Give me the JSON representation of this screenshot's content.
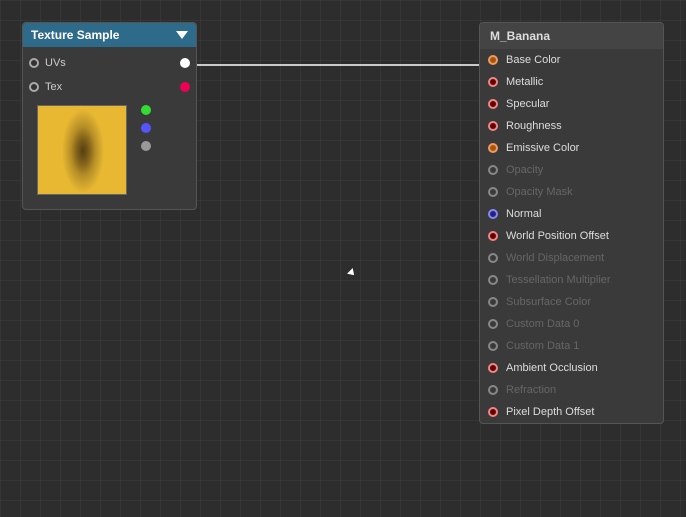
{
  "canvas": {
    "background": "#2d2d2d"
  },
  "texture_sample_node": {
    "title": "Texture Sample",
    "pins": [
      {
        "label": "UVs",
        "pin_color": "white",
        "side": "both"
      },
      {
        "label": "Tex",
        "pin_color": "red",
        "side": "right"
      }
    ],
    "output_pins": [
      "red",
      "green",
      "blue",
      "gray"
    ]
  },
  "material_node": {
    "title": "M_Banana",
    "rows": [
      {
        "label": "Base Color",
        "active": true,
        "pin_type": "orange"
      },
      {
        "label": "Metallic",
        "active": true,
        "pin_type": "default"
      },
      {
        "label": "Specular",
        "active": true,
        "pin_type": "default"
      },
      {
        "label": "Roughness",
        "active": true,
        "pin_type": "default"
      },
      {
        "label": "Emissive Color",
        "active": true,
        "pin_type": "orange"
      },
      {
        "label": "Opacity",
        "active": false,
        "pin_type": "disabled"
      },
      {
        "label": "Opacity Mask",
        "active": false,
        "pin_type": "disabled"
      },
      {
        "label": "Normal",
        "active": true,
        "pin_type": "blue-pin"
      },
      {
        "label": "World Position Offset",
        "active": true,
        "pin_type": "default"
      },
      {
        "label": "World Displacement",
        "active": false,
        "pin_type": "disabled"
      },
      {
        "label": "Tessellation Multiplier",
        "active": false,
        "pin_type": "disabled"
      },
      {
        "label": "Subsurface Color",
        "active": false,
        "pin_type": "disabled"
      },
      {
        "label": "Custom Data 0",
        "active": false,
        "pin_type": "disabled"
      },
      {
        "label": "Custom Data 1",
        "active": false,
        "pin_type": "disabled"
      },
      {
        "label": "Ambient Occlusion",
        "active": true,
        "pin_type": "default"
      },
      {
        "label": "Refraction",
        "active": false,
        "pin_type": "disabled"
      },
      {
        "label": "Pixel Depth Offset",
        "active": true,
        "pin_type": "default"
      }
    ]
  }
}
